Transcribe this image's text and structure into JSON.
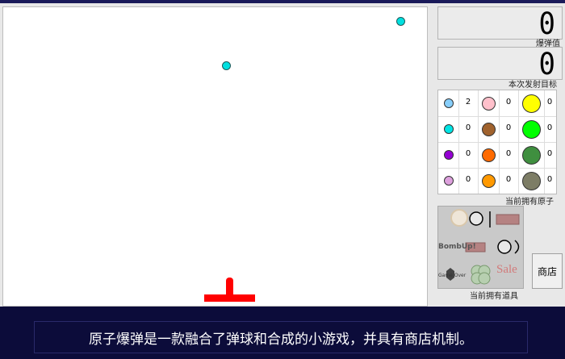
{
  "game": {
    "balls": [
      {
        "color": "#00e0e0"
      },
      {
        "color": "#00e0e0"
      }
    ],
    "launcher_color": "#ff0000"
  },
  "panel": {
    "bomb_value": "0",
    "bomb_value_label": "爆弹值",
    "launch_target": "0",
    "launch_target_label": "本次发射目标",
    "atoms_label": "当前拥有原子",
    "atoms": [
      {
        "color": "#87cefa",
        "count": "2"
      },
      {
        "color": "#ffc0cb",
        "count": "0"
      },
      {
        "color": "#ffff00",
        "count": "0"
      },
      {
        "color": "#00e5e5",
        "count": "0"
      },
      {
        "color": "#a0622d",
        "count": "0"
      },
      {
        "color": "#00ff00",
        "count": "0"
      },
      {
        "color": "#9400d3",
        "count": "0"
      },
      {
        "color": "#ff6a00",
        "count": "0"
      },
      {
        "color": "#3f8f3f",
        "count": "0"
      },
      {
        "color": "#dda0dd",
        "count": "0"
      },
      {
        "color": "#ff9900",
        "count": "0"
      },
      {
        "color": "#7d7d66",
        "count": "0"
      }
    ],
    "tools_label": "当前拥有道具",
    "tool_texts": {
      "bombup": "BombUp!",
      "gameover": "Game Over",
      "sale": "Sale"
    },
    "shop_label": "商店"
  },
  "footer": {
    "description": "原子爆弹是一款融合了弹球和合成的小游戏，并具有商店机制。"
  }
}
